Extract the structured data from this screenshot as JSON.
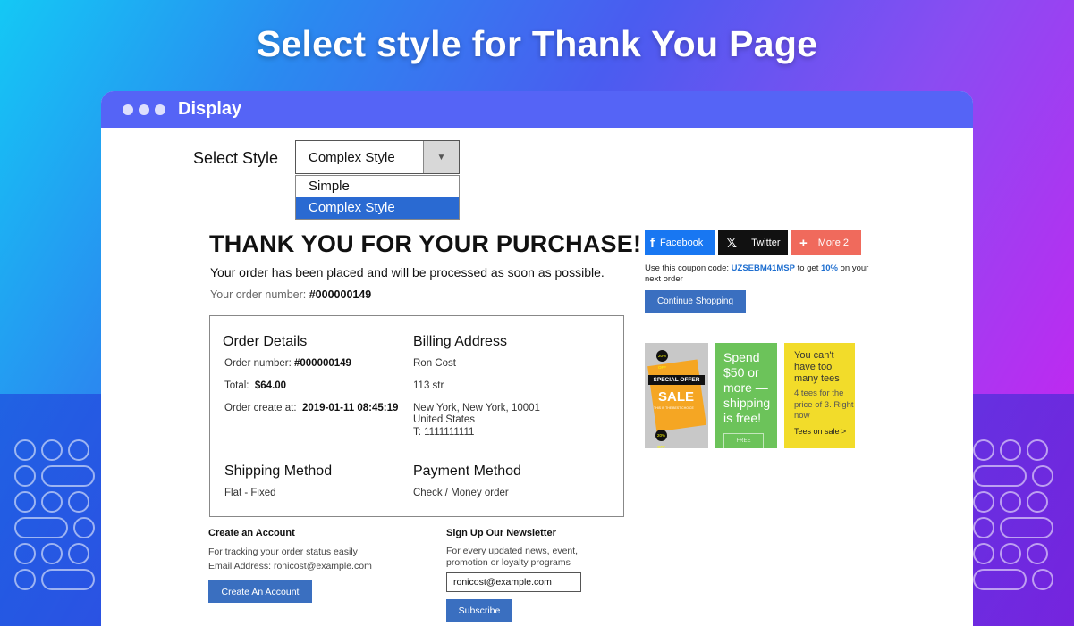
{
  "headline": "Select style for Thank You Page",
  "window": {
    "title": "Display"
  },
  "style_selector": {
    "label": "Select Style",
    "value": "Complex Style",
    "options": [
      "Simple",
      "Complex Style"
    ],
    "selected_option": "Complex Style"
  },
  "thank_you": {
    "title": "THANK YOU FOR YOUR PURCHASE!",
    "subtitle": "Your order has been placed and will be processed as soon as possible.",
    "order_label": "Your order number:",
    "order_number": "#000000149"
  },
  "order_details": {
    "heading": "Order Details",
    "order_number_label": "Order number:",
    "order_number": "#000000149",
    "total_label": "Total:",
    "total": "$64.00",
    "created_label": "Order create at:",
    "created": "2019-01-11 08:45:19"
  },
  "billing_address": {
    "heading": "Billing Address",
    "name": "Ron Cost",
    "street": "113 str",
    "city": "New York, New York, 10001",
    "country": "United States",
    "phone": "T: 1111111111"
  },
  "shipping_method": {
    "heading": "Shipping Method",
    "value": "Flat - Fixed"
  },
  "payment_method": {
    "heading": "Payment Method",
    "value": "Check / Money order"
  },
  "create_account": {
    "heading": "Create an Account",
    "line1": "For tracking your order status easily",
    "line2": "Email Address: ronicost@example.com",
    "button": "Create An Account"
  },
  "newsletter": {
    "heading": "Sign Up Our Newsletter",
    "line1": "For every updated news, event,",
    "line2": "promotion or loyalty programs",
    "email": "ronicost@example.com",
    "button": "Subscribe"
  },
  "share": {
    "facebook": "Facebook",
    "twitter": "Twitter",
    "more": "More 2",
    "colors": {
      "facebook": "#1877f2",
      "twitter": "#111111",
      "more": "#f06a5c"
    }
  },
  "coupon": {
    "pre": "Use this coupon code:",
    "code": "UZSEBM41MSP",
    "mid": "to get",
    "percent": "10%",
    "post": "on your next order"
  },
  "continue_button": "Continue Shopping",
  "ads": {
    "ad1": {
      "badge_top": "20% OFF",
      "special": "SPECIAL OFFER",
      "sale": "SALE",
      "tag": "THIS IS THE BEST CHOICE",
      "badge_bottom": "20% OFF"
    },
    "ad2": {
      "text": "Spend $50 or more — shipping is free!",
      "footer": "FREE SHIPPING"
    },
    "ad3": {
      "title": "You can't have too many tees",
      "sub": "4 tees for the price of 3. Right now",
      "cta": "Tees on sale >"
    }
  }
}
